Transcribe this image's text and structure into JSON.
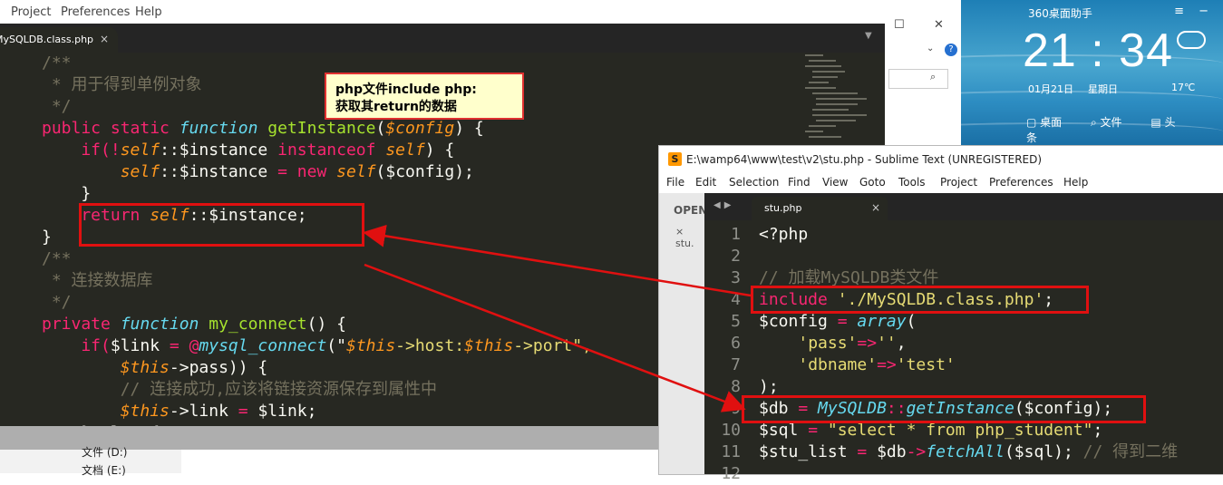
{
  "left_window": {
    "menu": [
      "Project",
      "Preferences",
      "Help"
    ],
    "tab": {
      "name": "MySQLDB.class.php",
      "close": "×"
    },
    "code_lines": [
      [
        {
          "t": "/**",
          "c": "cm"
        }
      ],
      [
        {
          "t": " * 用于得到单例对象",
          "c": "cm"
        }
      ],
      [
        {
          "t": " */",
          "c": "cm"
        }
      ],
      [
        {
          "t": "public static ",
          "c": "kw"
        },
        {
          "t": "function ",
          "c": "st"
        },
        {
          "t": "getInstance",
          "c": "fn"
        },
        {
          "t": "(",
          "c": ""
        },
        {
          "t": "$config",
          "c": "pa"
        },
        {
          "t": ") {",
          "c": ""
        }
      ],
      [
        {
          "t": "    if(",
          "c": "kw"
        },
        {
          "t": "!",
          "c": "op"
        },
        {
          "t": "self",
          "c": "sv"
        },
        {
          "t": "::$instance ",
          "c": ""
        },
        {
          "t": "instanceof ",
          "c": "kw"
        },
        {
          "t": "self",
          "c": "sv"
        },
        {
          "t": ") {",
          "c": ""
        }
      ],
      [
        {
          "t": "        ",
          "c": ""
        },
        {
          "t": "self",
          "c": "sv"
        },
        {
          "t": "::$instance ",
          "c": ""
        },
        {
          "t": "= ",
          "c": "op"
        },
        {
          "t": "new ",
          "c": "kw"
        },
        {
          "t": "self",
          "c": "sv"
        },
        {
          "t": "($config);",
          "c": ""
        }
      ],
      [
        {
          "t": "    }",
          "c": ""
        }
      ],
      [
        {
          "t": "    return ",
          "c": "kw"
        },
        {
          "t": "self",
          "c": "sv"
        },
        {
          "t": "::$instance;",
          "c": ""
        }
      ],
      [
        {
          "t": "}",
          "c": ""
        }
      ],
      [
        {
          "t": "/**",
          "c": "cm"
        }
      ],
      [
        {
          "t": " * 连接数据库",
          "c": "cm"
        }
      ],
      [
        {
          "t": " */",
          "c": "cm"
        }
      ],
      [
        {
          "t": "private ",
          "c": "kw"
        },
        {
          "t": "function ",
          "c": "st"
        },
        {
          "t": "my_connect",
          "c": "fn"
        },
        {
          "t": "() {",
          "c": ""
        }
      ],
      [
        {
          "t": "    if(",
          "c": "kw"
        },
        {
          "t": "$link ",
          "c": ""
        },
        {
          "t": "= @",
          "c": "op"
        },
        {
          "t": "mysql_connect",
          "c": "st"
        },
        {
          "t": "(\"",
          "c": ""
        },
        {
          "t": "$this",
          "c": "sv"
        },
        {
          "t": "->host:",
          "c": "str"
        },
        {
          "t": "$this",
          "c": "sv"
        },
        {
          "t": "->port\",",
          "c": "str"
        }
      ],
      [
        {
          "t": "        ",
          "c": ""
        },
        {
          "t": "$this",
          "c": "sv"
        },
        {
          "t": "->pass)) {",
          "c": ""
        }
      ],
      [
        {
          "t": "        // 连接成功,应该将链接资源保存到属性中",
          "c": "cm"
        }
      ],
      [
        {
          "t": "        ",
          "c": ""
        },
        {
          "t": "$this",
          "c": "sv"
        },
        {
          "t": "->link ",
          "c": ""
        },
        {
          "t": "= ",
          "c": "op"
        },
        {
          "t": "$link;",
          "c": ""
        }
      ],
      [
        {
          "t": "    } else {",
          "c": ""
        }
      ]
    ]
  },
  "taskbar_left": {
    "item1": "文件 (D:)",
    "item2": "文档 (E:)"
  },
  "widget": {
    "title": "360桌面助手",
    "time": "21 : 34",
    "date": "01月21日",
    "weekday": "星期日",
    "temp": "17℃",
    "bar": [
      "桌面",
      "文件",
      "头条"
    ]
  },
  "right_window": {
    "title": "E:\\wamp64\\www\\test\\v2\\stu.php - Sublime Text (UNREGISTERED)",
    "menu": [
      "File",
      "Edit",
      "Selection",
      "Find",
      "View",
      "Goto",
      "Tools",
      "Project",
      "Preferences",
      "Help"
    ],
    "sidebar_open": "OPEN",
    "sidebar_file": "stu.",
    "tab": {
      "name": "stu.php",
      "close": "×"
    },
    "line_numbers": [
      "1",
      "2",
      "3",
      "4",
      "5",
      "6",
      "7",
      "8",
      "9",
      "10",
      "11",
      "12"
    ],
    "code_lines": [
      [
        {
          "t": "<?php",
          "c": ""
        }
      ],
      [
        {
          "t": "",
          "c": ""
        }
      ],
      [
        {
          "t": "// 加载MySQLDB类文件",
          "c": "cm"
        }
      ],
      [
        {
          "t": "include ",
          "c": "kw"
        },
        {
          "t": "'./MySQLDB.class.php'",
          "c": "str"
        },
        {
          "t": ";",
          "c": ""
        }
      ],
      [
        {
          "t": "$config ",
          "c": ""
        },
        {
          "t": "= ",
          "c": "op"
        },
        {
          "t": "array",
          "c": "st"
        },
        {
          "t": "(",
          "c": ""
        }
      ],
      [
        {
          "t": "    ",
          "c": ""
        },
        {
          "t": "'pass'",
          "c": "str"
        },
        {
          "t": "=>",
          "c": "op"
        },
        {
          "t": "''",
          "c": "str"
        },
        {
          "t": ",",
          "c": ""
        }
      ],
      [
        {
          "t": "    ",
          "c": ""
        },
        {
          "t": "'dbname'",
          "c": "str"
        },
        {
          "t": "=>",
          "c": "op"
        },
        {
          "t": "'test'",
          "c": "str"
        }
      ],
      [
        {
          "t": ");",
          "c": ""
        }
      ],
      [
        {
          "t": "$db ",
          "c": ""
        },
        {
          "t": "= ",
          "c": "op"
        },
        {
          "t": "MySQLDB",
          "c": "st"
        },
        {
          "t": "::",
          "c": "op"
        },
        {
          "t": "getInstance",
          "c": "st"
        },
        {
          "t": "($config);",
          "c": ""
        }
      ],
      [
        {
          "t": "$sql ",
          "c": ""
        },
        {
          "t": "= ",
          "c": "op"
        },
        {
          "t": "\"select * from php_student\"",
          "c": "str"
        },
        {
          "t": ";",
          "c": ""
        }
      ],
      [
        {
          "t": "$stu_list ",
          "c": ""
        },
        {
          "t": "= ",
          "c": "op"
        },
        {
          "t": "$db",
          "c": ""
        },
        {
          "t": "->",
          "c": "op"
        },
        {
          "t": "fetchAll",
          "c": "st"
        },
        {
          "t": "($sql); ",
          "c": ""
        },
        {
          "t": "// 得到二维",
          "c": "cm"
        }
      ],
      [
        {
          "t": "",
          "c": ""
        }
      ]
    ]
  },
  "annotation": {
    "line1": "php文件include php:",
    "line2": "获取其return的数据"
  },
  "colors": {
    "editor_bg": "#272822",
    "annotation_border": "#e01010",
    "note_bg": "#ffffcc"
  }
}
